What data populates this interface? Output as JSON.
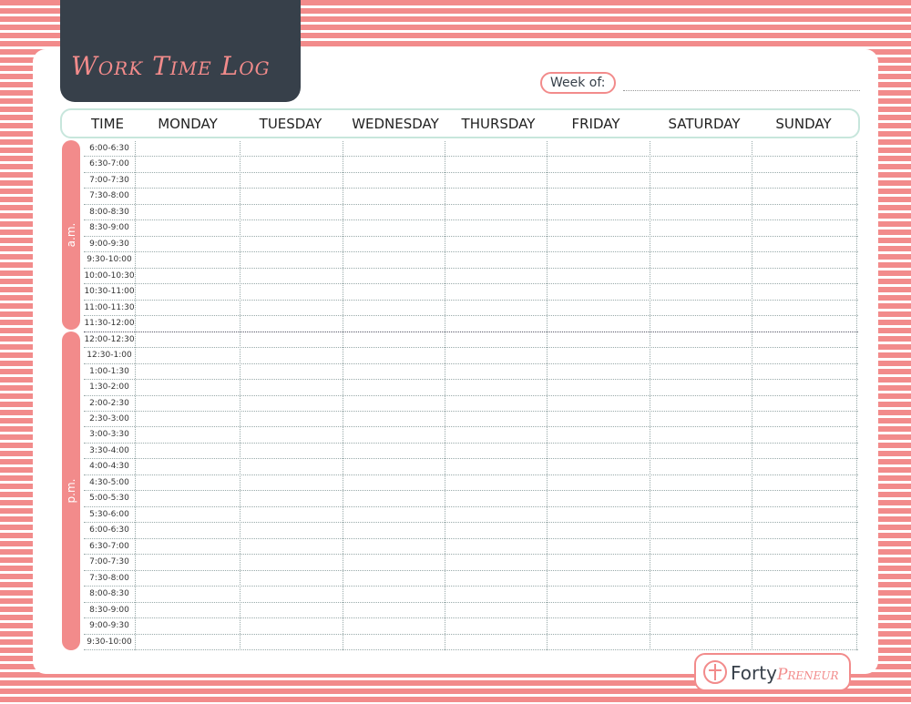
{
  "title": "Work Time Log",
  "week_label": "Week of:",
  "columns": [
    "TIME",
    "MONDAY",
    "TUESDAY",
    "WEDNESDAY",
    "THURSDAY",
    "FRIDAY",
    "SATURDAY",
    "SUNDAY"
  ],
  "periods": {
    "am": "a.m.",
    "pm": "p.m."
  },
  "time_slots": [
    "6:00-6:30",
    "6:30-7:00",
    "7:00-7:30",
    "7:30-8:00",
    "8:00-8:30",
    "8:30-9:00",
    "9:00-9:30",
    "9:30-10:00",
    "10:00-10:30",
    "10:30-11:00",
    "11:00-11:30",
    "11:30-12:00",
    "12:00-12:30",
    "12:30-1:00",
    "1:00-1:30",
    "1:30-2:00",
    "2:00-2:30",
    "2:30-3:00",
    "3:00-3:30",
    "3:30-4:00",
    "4:00-4:30",
    "4:30-5:00",
    "5:00-5:30",
    "5:30-6:00",
    "6:00-6:30",
    "6:30-7:00",
    "7:00-7:30",
    "7:30-8:00",
    "8:00-8:30",
    "8:30-9:00",
    "9:00-9:30",
    "9:30-10:00"
  ],
  "logo": {
    "part1": "Forty",
    "part2": "Preneur"
  },
  "colors": {
    "accent": "#f28b8b",
    "dark": "#37404a",
    "header_border": "#c7e6dc"
  }
}
